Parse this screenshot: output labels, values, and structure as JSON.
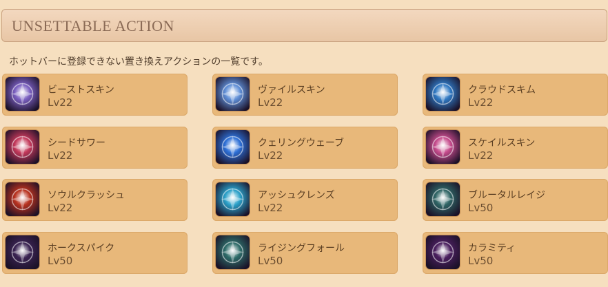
{
  "header": {
    "title": "UNSETTABLE ACTION"
  },
  "description": "ホットバーに登録できない置き換えアクションの一覧です。",
  "actions": [
    {
      "name": "ビーストスキン",
      "level": "Lv22",
      "icon": "beast-skin-icon",
      "color": "#7a5fc0"
    },
    {
      "name": "ヴァイルスキン",
      "level": "Lv22",
      "icon": "vile-skin-icon",
      "color": "#5f8ed6"
    },
    {
      "name": "クラウドスキム",
      "level": "Lv22",
      "icon": "cloud-skim-icon",
      "color": "#2f78c2"
    },
    {
      "name": "シードサワー",
      "level": "Lv22",
      "icon": "seed-sower-icon",
      "color": "#c3385a"
    },
    {
      "name": "クェリングウェーブ",
      "level": "Lv22",
      "icon": "quelling-wave-icon",
      "color": "#2d6fd6"
    },
    {
      "name": "スケイルスキン",
      "level": "Lv22",
      "icon": "scale-skin-icon",
      "color": "#c64b8c"
    },
    {
      "name": "ソウルクラッシュ",
      "level": "Lv22",
      "icon": "soul-crush-icon",
      "color": "#b8321f"
    },
    {
      "name": "アッシュクレンズ",
      "level": "Lv22",
      "icon": "ash-cleanse-icon",
      "color": "#2aa0c8"
    },
    {
      "name": "ブルータルレイジ",
      "level": "Lv50",
      "icon": "brutal-rage-icon",
      "color": "#2e6464"
    },
    {
      "name": "ホークスパイク",
      "level": "Lv50",
      "icon": "hawk-spike-icon",
      "color": "#3a2352"
    },
    {
      "name": "ライジングフォール",
      "level": "Lv50",
      "icon": "rising-fall-icon",
      "color": "#2d6b68"
    },
    {
      "name": "カラミティ",
      "level": "Lv50",
      "icon": "calamity-icon",
      "color": "#4a1f5e"
    }
  ]
}
